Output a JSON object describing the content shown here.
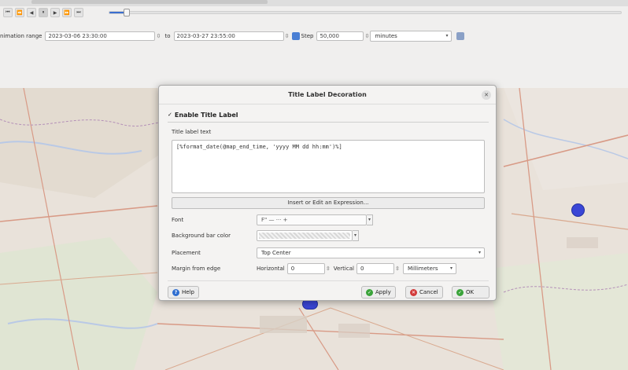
{
  "toolbar": {
    "buttons": [
      {
        "name": "skip-to-start-button",
        "glyph": "⏮"
      },
      {
        "name": "step-back-button",
        "glyph": "⏪"
      },
      {
        "name": "play-backward-button",
        "glyph": "◀"
      },
      {
        "name": "pause-button",
        "glyph": "⏸"
      },
      {
        "name": "play-forward-button",
        "glyph": "▶"
      },
      {
        "name": "step-forward-button",
        "glyph": "⏩"
      },
      {
        "name": "skip-to-end-button",
        "glyph": "⏭"
      }
    ],
    "progress": 0.03
  },
  "range": {
    "label": "nimation range",
    "start": "2023-03-06 23:30:00",
    "to_label": "to",
    "end": "2023-03-27 23:55:00",
    "step_label": "Step",
    "step_value": "50,000",
    "step_unit": "minutes"
  },
  "dialog": {
    "title": "Title Label Decoration",
    "enable_label": "Enable Title Label",
    "title_label_text_label": "Title label text",
    "expression": "[%format_date(@map_end_time, 'yyyy MM dd hh:mm')%]",
    "insert_button": "Insert or Edit an Expression...",
    "font_label": "Font",
    "font_value": "F\" — ··· +",
    "bg_label": "Background bar color",
    "placement_label": "Placement",
    "placement_value": "Top Center",
    "margin_label": "Margin from edge",
    "horizontal_label": "Horizontal",
    "horizontal_value": "0",
    "vertical_label": "Vertical",
    "vertical_value": "0",
    "unit_value": "Millimeters",
    "help_button": "Help",
    "apply_button": "Apply",
    "cancel_button": "Cancel",
    "ok_button": "OK"
  },
  "colors": {
    "accent": "#3a6ecf",
    "map_point": "#3a46d6",
    "ok_green": "#3aa33a",
    "cancel_red": "#d23a3a",
    "help_blue": "#2f6ed0"
  }
}
